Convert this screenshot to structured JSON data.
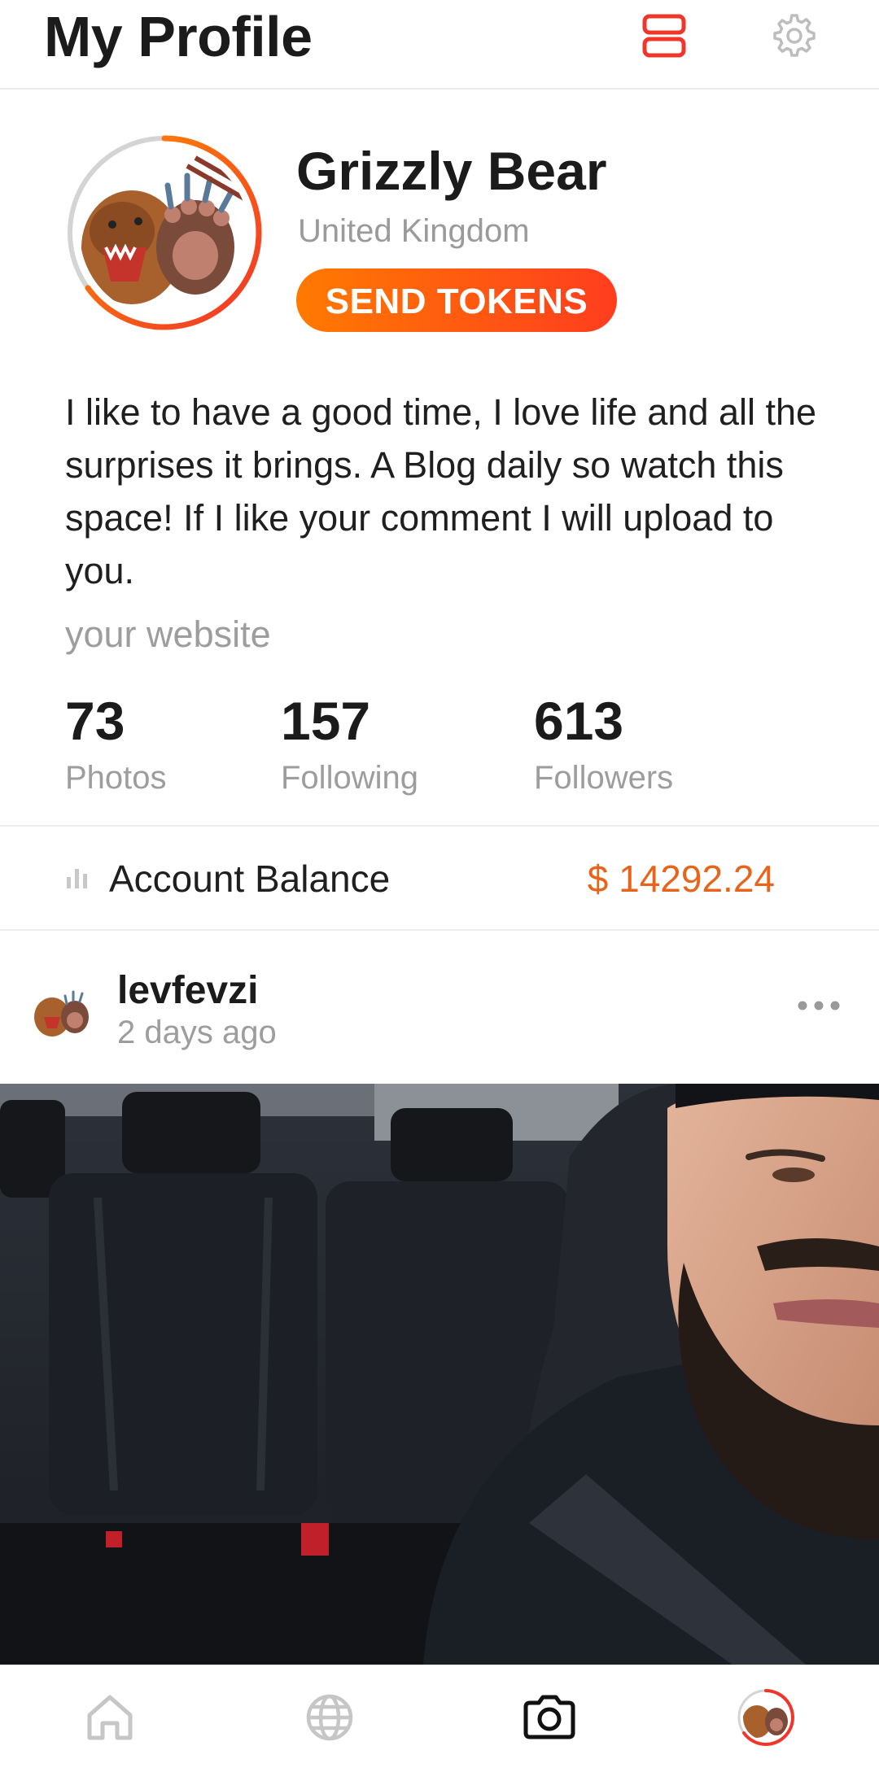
{
  "header": {
    "title": "My Profile",
    "icons": [
      "layout-toggle-icon",
      "gear-icon"
    ],
    "accent": "#f0352a"
  },
  "profile": {
    "name": "Grizzly Bear",
    "country": "United Kingdom",
    "send_tokens_label": "SEND TOKENS",
    "avatar": "grizzly-bear-avatar",
    "bio": "I like to have a good time, I love life and all the surprises it brings. A Blog daily so watch this space! If I like your comment I will upload to you.",
    "website": "your website"
  },
  "stats": [
    {
      "value": "73",
      "label": "Photos"
    },
    {
      "value": "157",
      "label": "Following"
    },
    {
      "value": "613",
      "label": "Followers"
    }
  ],
  "balance": {
    "label": "Account Balance",
    "value": "$ 14292.24",
    "color": "#e8641a",
    "icon": "bar-chart-icon"
  },
  "post": {
    "username": "levfevzi",
    "time": "2 days ago",
    "menu_icon": "more-horizontal-icon"
  },
  "tabbar": {
    "items": [
      "home-icon",
      "globe-icon",
      "camera-icon",
      "profile-avatar-icon"
    ],
    "active": "camera-icon"
  }
}
